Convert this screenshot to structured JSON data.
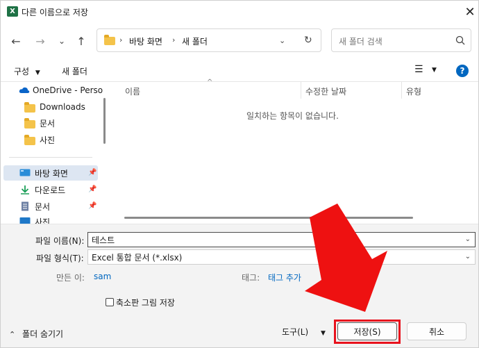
{
  "window": {
    "title": "다른 이름으로 저장",
    "app_icon_letter": "X"
  },
  "address": {
    "segments": [
      "바탕 화면",
      "새 폴더"
    ]
  },
  "search": {
    "placeholder": "새 폴더 검색"
  },
  "toolbar": {
    "organize_label": "구성",
    "new_folder_label": "새 폴더"
  },
  "sidebar": {
    "items": [
      {
        "label": "OneDrive - Perso",
        "icon": "cloud-icon"
      },
      {
        "label": "Downloads",
        "icon": "folder-icon"
      },
      {
        "label": "문서",
        "icon": "folder-icon"
      },
      {
        "label": "사진",
        "icon": "folder-icon"
      },
      {
        "label": "바탕 화면",
        "icon": "desktop-icon",
        "selected": true,
        "pinned": true
      },
      {
        "label": "다운로드",
        "icon": "download-icon",
        "pinned": true
      },
      {
        "label": "문서",
        "icon": "document-icon",
        "pinned": true
      },
      {
        "label": "사진",
        "icon": "pictures-icon"
      }
    ]
  },
  "file_list": {
    "columns": [
      "이름",
      "수정한 날짜",
      "유형"
    ],
    "empty_message": "일치하는 항목이 없습니다."
  },
  "form": {
    "filename_label": "파일 이름(N):",
    "filename_value": "테스트",
    "filetype_label": "파일 형식(T):",
    "filetype_value": "Excel 통합 문서 (*.xlsx)",
    "author_label": "만든 이:",
    "author_value": "sam",
    "tags_label": "태그:",
    "tags_value": "태그 추가",
    "thumbnail_label": "축소판 그림 저장",
    "thumbnail_checked": false
  },
  "footer": {
    "hide_folders_label": "폴더 숨기기",
    "tools_label": "도구(L)",
    "save_label": "저장(S)",
    "cancel_label": "취소"
  },
  "colors": {
    "accent": "#0067c0",
    "highlight": "#e8121d",
    "excel_green": "#1e7145"
  }
}
